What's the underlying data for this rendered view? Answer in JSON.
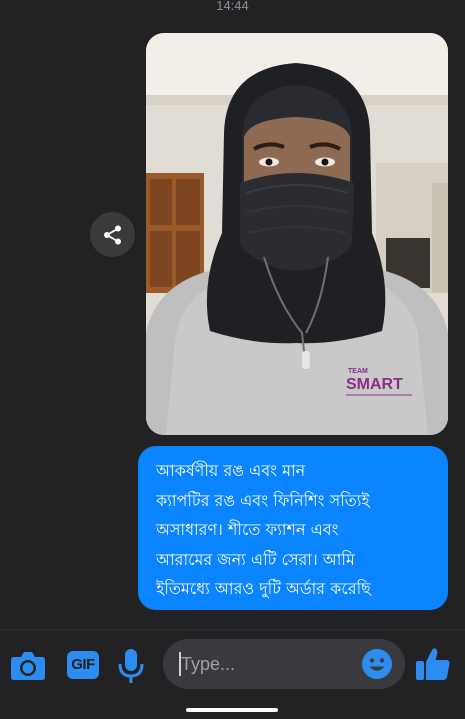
{
  "status": {
    "time": "14:44"
  },
  "conversation": {
    "photo_message": {
      "shirt_brand_small": "TEAM",
      "shirt_brand": "SMART",
      "description": "photo attachment"
    },
    "text_message": {
      "text": "আকর্ষণীয় রঙ এবং মান\nক্যাপটির রঙ এবং ফিনিশিং সত্যিই\nঅসাধারণ। শীতে ফ্যাশন এবং\nআরামের জন্য এটি সেরা। আমি\nইতিমধ্যে আরও দুটি অর্ডার করেছি"
    }
  },
  "composer": {
    "placeholder": "Type...",
    "value": "",
    "gif_label": "GIF",
    "icons": {
      "camera": "camera-icon",
      "gif": "gif-icon",
      "mic": "microphone-icon",
      "emoji": "emoji-icon",
      "like": "thumbs-up-icon",
      "share": "share-icon"
    }
  },
  "colors": {
    "background": "#222225",
    "bubble": "#0a84ff",
    "accent": "#2d8cf0",
    "input_bg": "#3a3a3e"
  }
}
